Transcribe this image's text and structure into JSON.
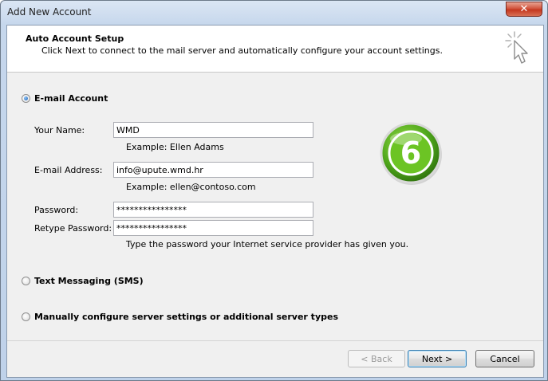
{
  "window": {
    "title": "Add New Account",
    "close_glyph": "✕"
  },
  "header": {
    "title": "Auto Account Setup",
    "description": "Click Next to connect to the mail server and automatically configure your account settings.",
    "icon": "cursor-click-icon"
  },
  "options": {
    "email_account": {
      "label": "E-mail Account",
      "selected": true
    },
    "text_messaging": {
      "label": "Text Messaging (SMS)",
      "selected": false
    },
    "manual": {
      "label": "Manually configure server settings or additional server types",
      "selected": false
    }
  },
  "form": {
    "name": {
      "label": "Your Name:",
      "value": "WMD",
      "hint": "Example: Ellen Adams"
    },
    "email": {
      "label": "E-mail Address:",
      "value": "info@upute.wmd.hr",
      "hint": "Example: ellen@contoso.com"
    },
    "password": {
      "label": "Password:",
      "value": "****************"
    },
    "retype": {
      "label": "Retype Password:",
      "value": "****************",
      "hint": "Type the password your Internet service provider has given you."
    }
  },
  "badge": {
    "number": "6",
    "colors": {
      "outer": "#4a9a1a",
      "inner": "#6cc424",
      "ring": "#ffffff"
    }
  },
  "buttons": {
    "back": "< Back",
    "next": "Next >",
    "cancel": "Cancel"
  }
}
